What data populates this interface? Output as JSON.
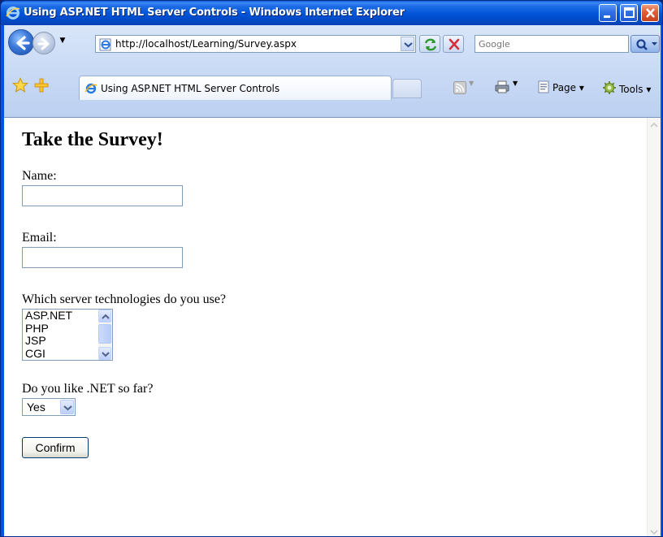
{
  "window": {
    "title": "Using ASP.NET HTML Server Controls - Windows Internet Explorer"
  },
  "address_bar": {
    "url": "http://localhost/Learning/Survey.aspx"
  },
  "search": {
    "placeholder": "Google"
  },
  "tab": {
    "label": "Using ASP.NET HTML Server Controls"
  },
  "command_bar": {
    "page_label": "Page",
    "tools_label": "Tools"
  },
  "page": {
    "heading": "Take the Survey!",
    "name_label": "Name:",
    "name_value": "",
    "email_label": "Email:",
    "email_value": "",
    "tech_label": "Which server technologies do you use?",
    "tech_options": [
      "ASP.NET",
      "PHP",
      "JSP",
      "CGI"
    ],
    "like_label": "Do you like .NET so far?",
    "like_selected": "Yes",
    "confirm_label": "Confirm"
  },
  "colors": {
    "title_bar": "#0054e3",
    "chrome": "#c9daf5",
    "input_border": "#7f9db9"
  }
}
